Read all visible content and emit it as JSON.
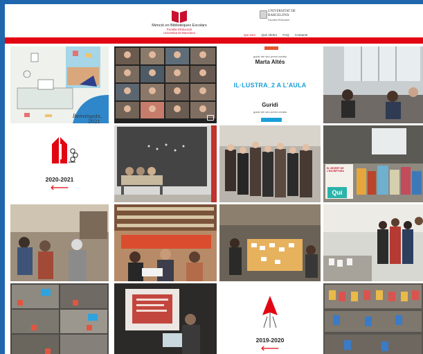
{
  "header": {
    "site_name": "Menció en Biblioteques Escolars",
    "faculty_line1": "Facultat d'Educació",
    "faculty_line2": "Universitat de Barcelona",
    "ub_name_line1": "UNIVERSITAT DE",
    "ub_name_line2": "BARCELONA",
    "ub_sub": "Facultat d'Educació",
    "nav": [
      {
        "label": "Qui som",
        "active": true
      },
      {
        "label": "Què oferim",
        "active": false
      },
      {
        "label": "FAQ",
        "active": false
      },
      {
        "label": "Contacte",
        "active": false
      }
    ]
  },
  "colors": {
    "brand_red": "#e20613",
    "poster_blue": "#1aa0d8",
    "outer_blue": "#1f66ad"
  },
  "tiles": {
    "welcome_text": "Benvinguts,",
    "welcome_year": "2021",
    "poster_subtitle_1": "guiat/ del seu premi creatiu",
    "poster_name_1": "Marta Altés",
    "poster_title": "IL·LUSTRA_2 A L'AULA",
    "poster_name_2": "Guridi",
    "poster_subtitle_2": "guiat/ del seu premi creatiu",
    "year_2020_2021": "2020-2021",
    "year_2019_2020": "2019-2020",
    "arrow_glyph": "🡐",
    "book_cover_text": "EL SECRET DE L'ESCRIPTURA",
    "book_logo_text": "Qui"
  }
}
